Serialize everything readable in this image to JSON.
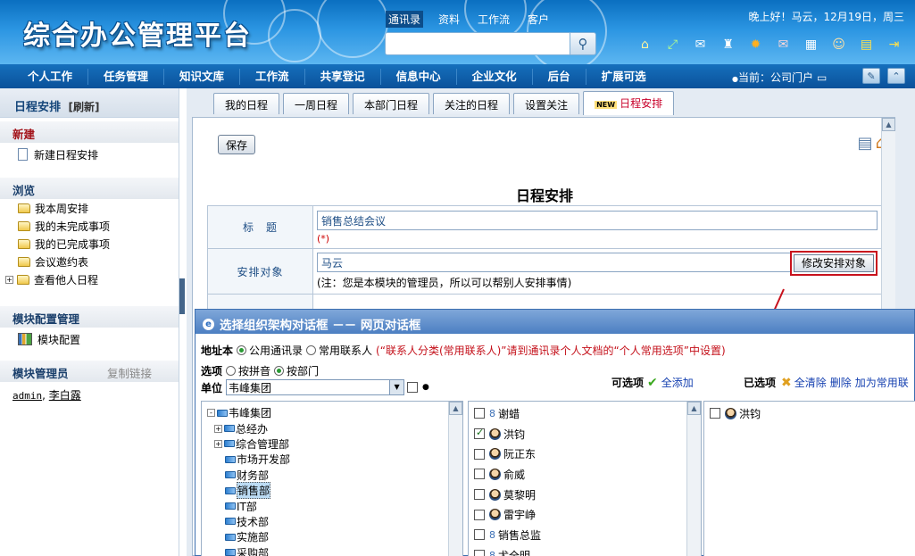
{
  "header": {
    "logo": "综合办公管理平台",
    "search_tabs": [
      "通讯录",
      "资料",
      "工作流",
      "客户"
    ],
    "greeting": "晚上好！马云，12月19日，周三",
    "tool_icons": [
      "home-icon",
      "share-icon",
      "mail-icon",
      "shirt-icon",
      "sun-icon",
      "envelope-icon",
      "calendar-icon",
      "contacts-icon",
      "note-icon",
      "exit-icon"
    ]
  },
  "nav": {
    "items": [
      "个人工作",
      "任务管理",
      "知识文库",
      "工作流",
      "共享登记",
      "信息中心",
      "企业文化",
      "后台",
      "扩展可选"
    ],
    "current": "当前：公司门户"
  },
  "sidebar": {
    "title": "日程安排",
    "refresh": "[刷新]",
    "new_section": "新建",
    "new_item": "新建日程安排",
    "browse_section": "浏览",
    "browse_items": [
      "我本周安排",
      "我的未完成事项",
      "我的已完成事项",
      "会议邀约表",
      "查看他人日程"
    ],
    "config_section": "模块配置管理",
    "config_item": "模块配置",
    "admin_section": "模块管理员",
    "copy_link": "复制链接",
    "admins": [
      "admin",
      "李白露"
    ]
  },
  "tabs": [
    "我的日程",
    "一周日程",
    "本部门日程",
    "关注的日程",
    "设置关注",
    "日程安排"
  ],
  "tab_new_badge": "NEW",
  "form": {
    "save": "保存",
    "title": "日程安排",
    "title_label": "标　题",
    "title_value": "销售总结会议",
    "required": "(*)",
    "target_label": "安排对象",
    "target_value": "马云",
    "modify_btn": "修改安排对象",
    "note": "(注：您是本模块的管理员，所以可以帮别人安排事情)"
  },
  "dialog": {
    "title": "选择组织架构对话框 －－ 网页对话框",
    "addr_label": "地址本",
    "addr_opt1": "公用通讯录",
    "addr_opt2": "常用联系人",
    "addr_hint": "(“联系人分类(常用联系人)”请到通讯录个人文档的“个人常用选项”中设置)",
    "option_label": "选项",
    "opt_pinyin": "按拼音",
    "opt_dept": "按部门",
    "unit_label": "单位",
    "unit_value": "韦峰集团",
    "available_label": "可选项",
    "add_all": "全添加",
    "selected_label": "已选项",
    "clear_all": "全清除",
    "delete": "删除",
    "add_common": "加为常用联",
    "tree": [
      {
        "label": "韦峰集团",
        "level": 0,
        "expander": "-"
      },
      {
        "label": "总经办",
        "level": 1,
        "expander": "+"
      },
      {
        "label": "综合管理部",
        "level": 1,
        "expander": "+"
      },
      {
        "label": "市场开发部",
        "level": 1,
        "expander": ""
      },
      {
        "label": "财务部",
        "level": 1,
        "expander": ""
      },
      {
        "label": "销售部",
        "level": 1,
        "expander": "",
        "selected": true
      },
      {
        "label": "IT部",
        "level": 1,
        "expander": ""
      },
      {
        "label": "技术部",
        "level": 1,
        "expander": ""
      },
      {
        "label": "实施部",
        "level": 1,
        "expander": ""
      },
      {
        "label": "采购部",
        "level": 1,
        "expander": ""
      }
    ],
    "people": [
      {
        "name": "谢蜡",
        "checked": false,
        "icon": "role-icon"
      },
      {
        "name": "洪钧",
        "checked": true,
        "icon": "person-icon"
      },
      {
        "name": "阮正东",
        "checked": false,
        "icon": "person-icon"
      },
      {
        "name": "俞威",
        "checked": false,
        "icon": "person-icon"
      },
      {
        "name": "莫黎明",
        "checked": false,
        "icon": "person-icon"
      },
      {
        "name": "雷宇峥",
        "checked": false,
        "icon": "person-icon"
      },
      {
        "name": "销售总监",
        "checked": false,
        "icon": "role-icon"
      },
      {
        "name": "尤全明",
        "checked": false,
        "icon": "role-icon"
      }
    ],
    "selected": [
      {
        "name": "洪钧",
        "checked": false
      }
    ]
  },
  "colors": {
    "header_blue": "#2b95e2",
    "nav_blue": "#0a519a",
    "highlight_red": "#c8121d"
  }
}
